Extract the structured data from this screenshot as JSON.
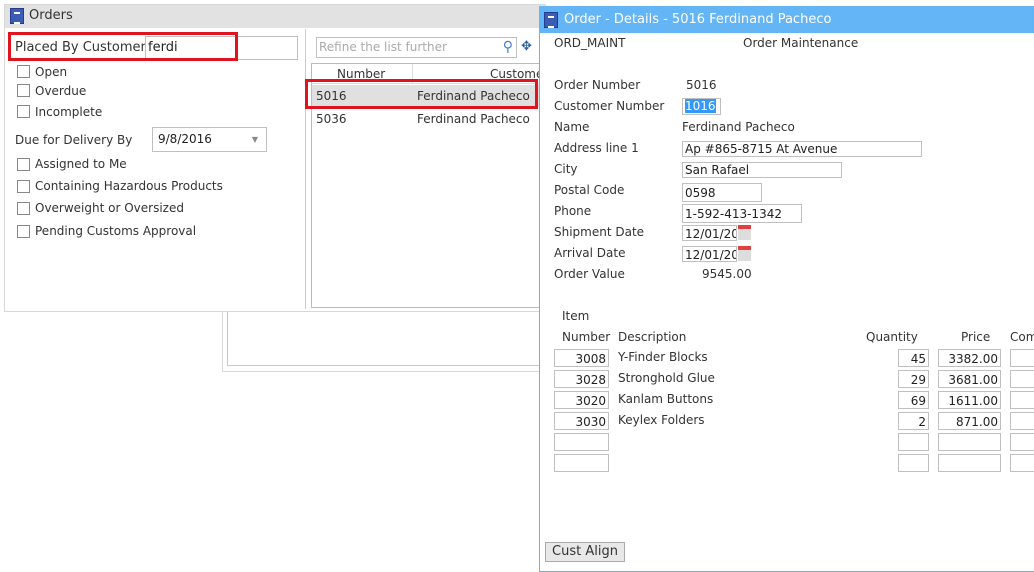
{
  "orders_window": {
    "title": "Orders",
    "placed_by_label": "Placed By Customer",
    "placed_by_value": "ferdi",
    "checkboxes_top": [
      "Open",
      "Overdue",
      "Incomplete"
    ],
    "due_label": "Due for Delivery By",
    "due_value": "9/8/2016",
    "checkboxes_bottom": [
      "Assigned to Me",
      "Containing Hazardous Products",
      "Overweight or Oversized",
      "Pending Customs Approval"
    ],
    "search_placeholder": "Refine the list further",
    "columns": [
      "Number",
      "Customer"
    ],
    "rows": [
      {
        "number": "5016",
        "customer": "Ferdinand Pacheco"
      },
      {
        "number": "5036",
        "customer": "Ferdinand Pacheco"
      }
    ]
  },
  "details_window": {
    "title": "Order - Details - 5016 Ferdinand Pacheco",
    "program_code": "ORD_MAINT",
    "program_name": "Order Maintenance",
    "fields": {
      "order_number_label": "Order Number",
      "order_number": "5016",
      "customer_number_label": "Customer Number",
      "customer_number": "1016",
      "name_label": "Name",
      "name": "Ferdinand Pacheco",
      "address_label": "Address line 1",
      "address": "Ap #865-8715 At Avenue",
      "city_label": "City",
      "city": "San Rafael",
      "postal_label": "Postal Code",
      "postal": "0598",
      "phone_label": "Phone",
      "phone": "1-592-413-1342",
      "shipment_label": "Shipment Date",
      "shipment": "12/01/20",
      "arrival_label": "Arrival Date",
      "arrival": "12/01/20",
      "value_label": "Order Value",
      "value": "9545.00"
    },
    "items_header": {
      "item": "Item",
      "number": "Number",
      "description": "Description",
      "quantity": "Quantity",
      "price": "Price",
      "comment": "Com"
    },
    "items": [
      {
        "number": "3008",
        "description": "Y-Finder Blocks",
        "quantity": "45",
        "price": "3382.00"
      },
      {
        "number": "3028",
        "description": "Stronghold Glue",
        "quantity": "29",
        "price": "3681.00"
      },
      {
        "number": "3020",
        "description": "Kanlam Buttons",
        "quantity": "69",
        "price": "1611.00"
      },
      {
        "number": "3030",
        "description": "Keylex Folders",
        "quantity": "2",
        "price": "871.00"
      },
      {
        "number": "",
        "description": "",
        "quantity": "",
        "price": ""
      },
      {
        "number": "",
        "description": "",
        "quantity": "",
        "price": ""
      }
    ],
    "cust_align_label": "Cust Align"
  }
}
